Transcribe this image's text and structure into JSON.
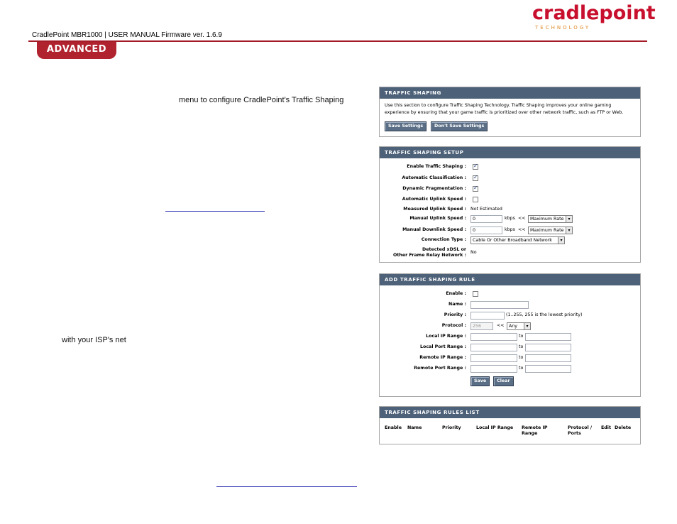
{
  "logo": {
    "word": "cradlepoint",
    "sub": "TECHNOLOGY"
  },
  "doc": {
    "header": "CradlePoint MBR1000 | USER MANUAL Firmware ver. 1.6.9",
    "section_tab": "ADVANCED"
  },
  "body_fragments": {
    "line1": "menu  to  configure  CradlePoint's  Traffic  Shaping",
    "line2": "with  your  ISP's  net"
  },
  "traffic_shaping": {
    "title": "TRAFFIC SHAPING",
    "description": "Use this section to configure Traffic Shaping Technology. Traffic Shaping improves your online gaming experience by ensuring that your game traffic is prioritized over other network traffic, such as FTP or Web.",
    "save_label": "Save Settings",
    "dont_save_label": "Don't Save Settings"
  },
  "setup": {
    "title": "TRAFFIC SHAPING SETUP",
    "enable_label": "Enable Traffic Shaping :",
    "enable_checked": true,
    "auto_class_label": "Automatic Classification :",
    "auto_class_checked": true,
    "dyn_frag_label": "Dynamic Fragmentation :",
    "dyn_frag_checked": true,
    "auto_uplink_label": "Automatic Uplink Speed :",
    "auto_uplink_checked": false,
    "measured_label": "Measured Uplink Speed :",
    "measured_value": "Not Estimated",
    "manual_uplink_label": "Manual Uplink Speed :",
    "manual_uplink_value": "0",
    "manual_downlink_label": "Manual Downlink Speed :",
    "manual_downlink_value": "0",
    "kbps": "kbps",
    "arrows": "<<",
    "rate_option": "Maximum Rate",
    "conn_type_label": "Connection Type :",
    "conn_type_value": "Cable Or Other Broadband Network",
    "xdsl_label_1": "Detected xDSL or",
    "xdsl_label_2": "Other Frame Relay Network :",
    "xdsl_value": "No"
  },
  "add_rule": {
    "title": "ADD TRAFFIC SHAPING RULE",
    "enable_label": "Enable :",
    "name_label": "Name :",
    "name_value": "",
    "priority_label": "Priority :",
    "priority_value": "",
    "priority_hint": "(1..255, 255 is the lowest priority)",
    "protocol_label": "Protocol :",
    "protocol_value": "256",
    "arrows": "<<",
    "protocol_option": "Any",
    "local_ip_label": "Local IP Range :",
    "local_port_label": "Local Port Range :",
    "remote_ip_label": "Remote IP Range :",
    "remote_port_label": "Remote Port Range :",
    "to": "to",
    "save_label": "Save",
    "clear_label": "Clear"
  },
  "rules_list": {
    "title": "TRAFFIC SHAPING RULES LIST",
    "columns": [
      "Enable",
      "Name",
      "Priority",
      "Local IP Range",
      "Remote IP\nRange",
      "Protocol /\nPorts",
      "Edit",
      "Delete"
    ]
  },
  "colors": {
    "brand_red": "#c8102e",
    "panel_header": "#4d6179",
    "button": "#5a6e86"
  }
}
